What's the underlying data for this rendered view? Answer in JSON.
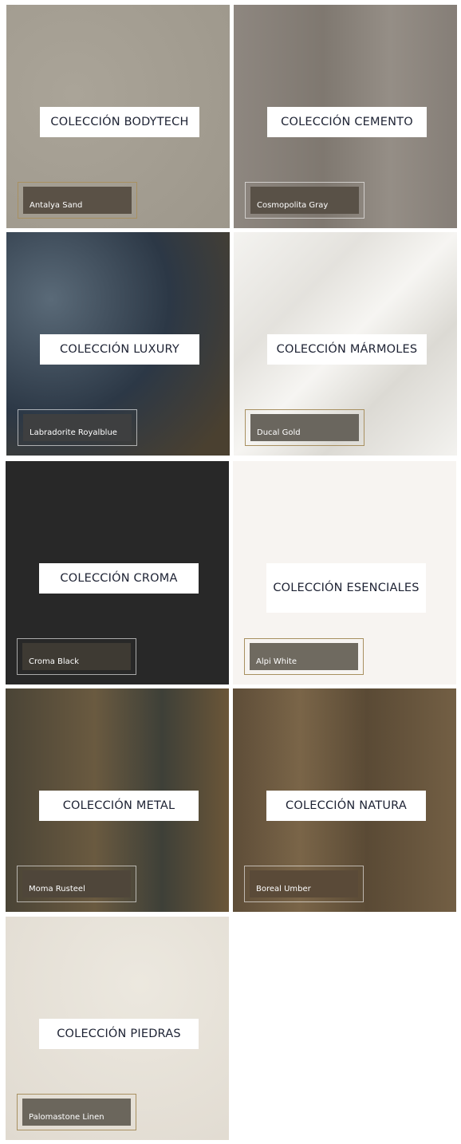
{
  "collections": [
    {
      "title": "COLECCIÓN BODYTECH",
      "product": "Antalya Sand",
      "frame": "gold",
      "bg": "#a39d91"
    },
    {
      "title": "COLECCIÓN CEMENTO",
      "product": "Cosmopolita Gray",
      "frame": "light",
      "bg": "#8a837c"
    },
    {
      "title": "COLECCIÓN LUXURY",
      "product": "Labradorite Royalblue",
      "frame": "light",
      "bg": "#3b4a58"
    },
    {
      "title": "COLECCIÓN MÁRMOLES",
      "product": "Ducal Gold",
      "frame": "gold",
      "bg": "#efeeeb"
    },
    {
      "title": "COLECCIÓN CROMA",
      "product": "Croma Black",
      "frame": "light",
      "bg": "#282828"
    },
    {
      "title": "COLECCIÓN ESENCIALES",
      "product": "Alpi White",
      "frame": "gold",
      "bg": "#f7f4f1"
    },
    {
      "title": "COLECCIÓN METAL",
      "product": "Moma Rusteel",
      "frame": "light",
      "bg": "#5b5140"
    },
    {
      "title": "COLECCIÓN NATURA",
      "product": "Boreal Umber",
      "frame": "light",
      "bg": "#6b5a42"
    },
    {
      "title": "COLECCIÓN PIEDRAS",
      "product": "Palomastone Linen",
      "frame": "gold",
      "bg": "#e6e1d8"
    }
  ]
}
